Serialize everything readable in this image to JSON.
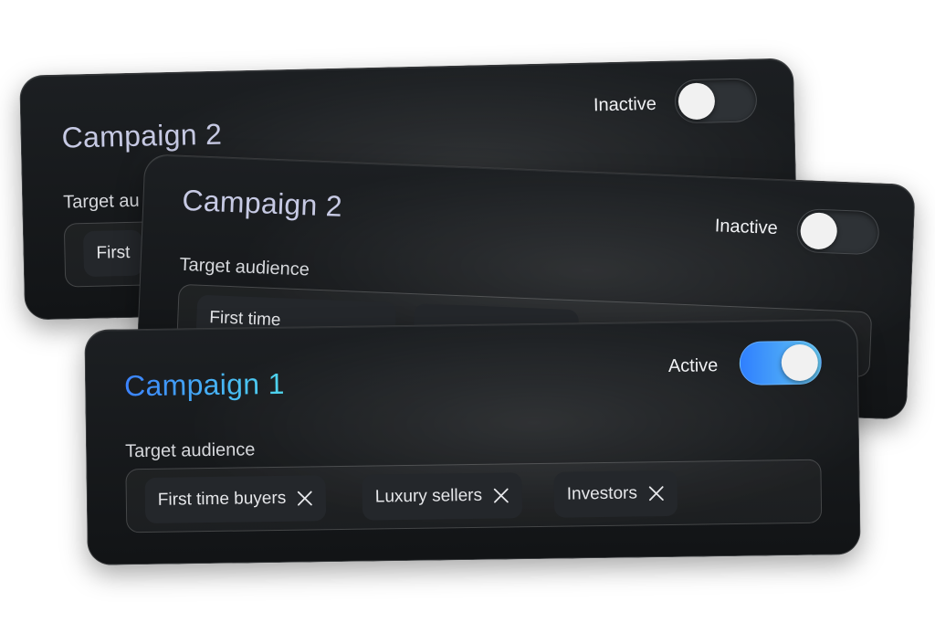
{
  "cards": {
    "back": {
      "title": "Campaign 2",
      "status": "Inactive",
      "section_label": "Target au",
      "chip_label": "First"
    },
    "middle": {
      "title": "Campaign 2",
      "status": "Inactive",
      "section_label": "Target audience",
      "chip_label": "First time"
    },
    "front": {
      "title": "Campaign 1",
      "status": "Active",
      "section_label": "Target audience",
      "tags": [
        "First time buyers",
        "Luxury sellers",
        "Investors"
      ]
    }
  },
  "toggle_states": {
    "back": "off",
    "middle": "off",
    "front": "on"
  },
  "colors": {
    "card_bg": "#16191b",
    "title_muted": "#c6c9e3",
    "title_gradient_start": "#3b82ff",
    "title_gradient_end": "#4fd6ec",
    "toggle_on_start": "#2f7fff",
    "toggle_on_end": "#62c6f2"
  },
  "icons": {
    "remove": "close-icon"
  }
}
